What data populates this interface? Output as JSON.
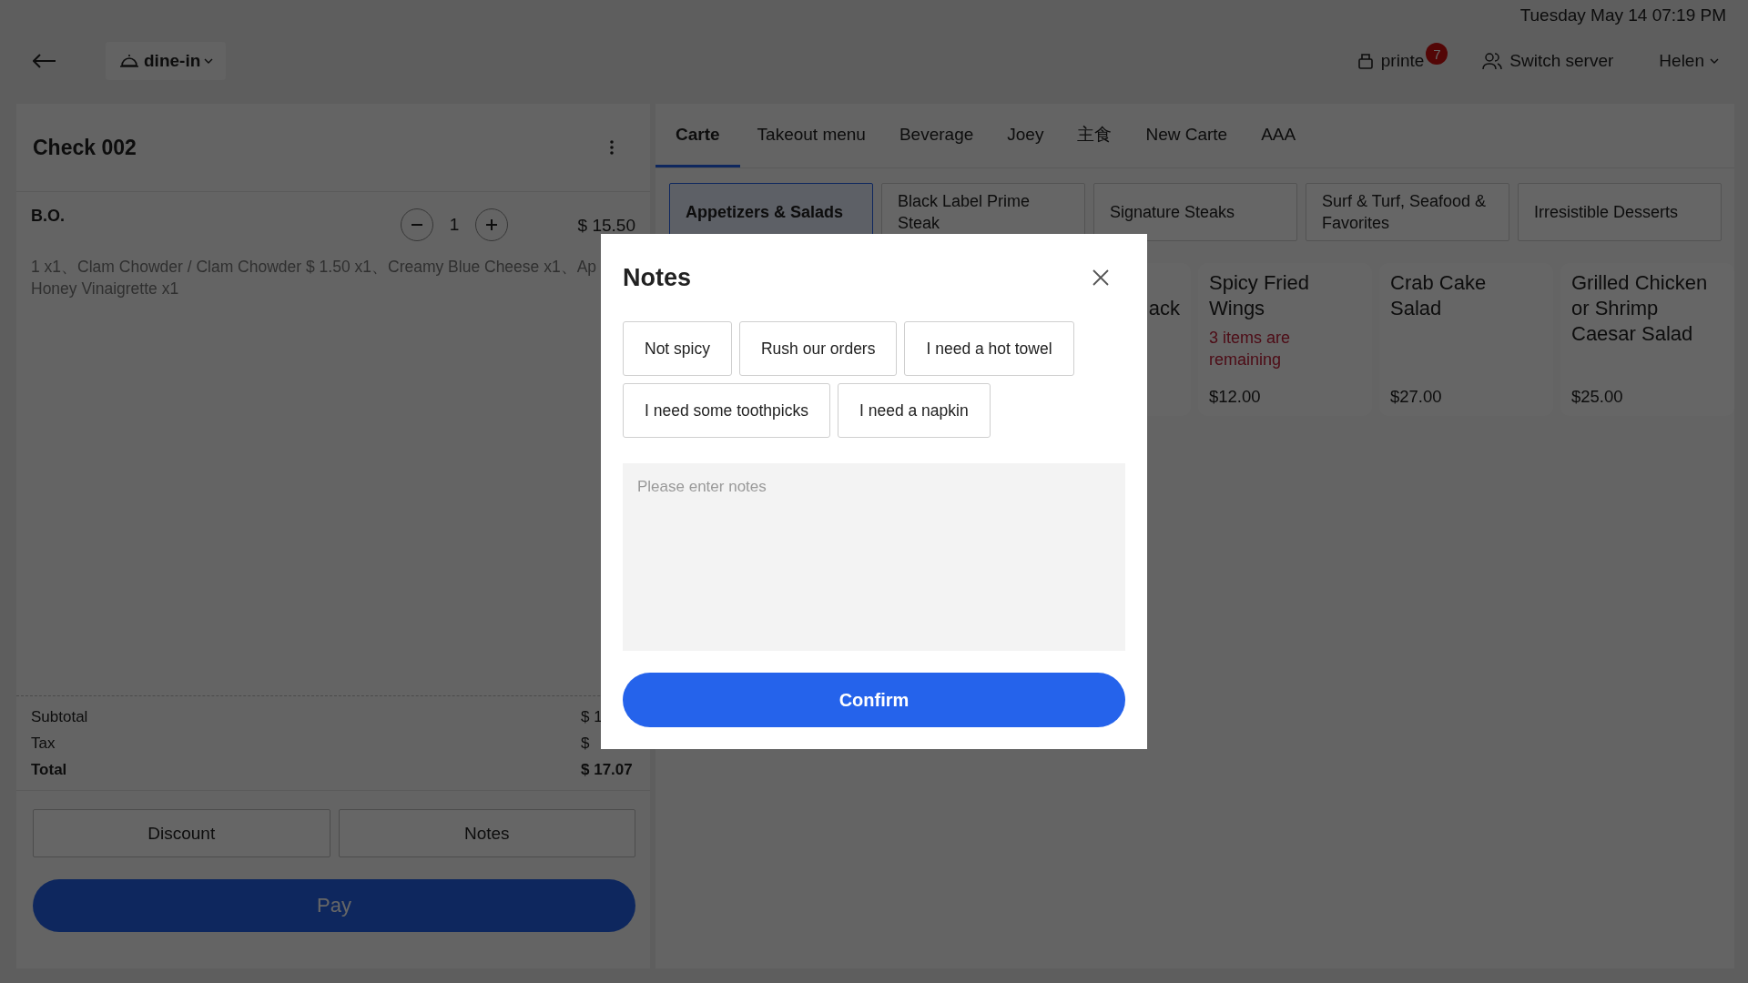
{
  "status": {
    "datetime": "Tuesday May 14 07:19 PM"
  },
  "header": {
    "order_type": "dine-in",
    "printer": {
      "label": "printe",
      "badge": "7"
    },
    "switch_server": "Switch server",
    "user": "Helen"
  },
  "check": {
    "title": "Check 002",
    "items": [
      {
        "name": "B.O.",
        "quantity": "1",
        "price": "$ 15.50",
        "modifiers": [
          "1 x1、Clam Chowder / Clam Chowder $ 1.50 x1、Creamy Blue Cheese x1、Ap",
          "Honey Vinaigrette x1"
        ]
      }
    ],
    "summary": [
      {
        "label": "Subtotal",
        "value": "$ 1",
        "kind": "normal"
      },
      {
        "label": "Tax",
        "value": "$",
        "kind": "normal"
      },
      {
        "label": "Total",
        "value": "$ 17.07",
        "kind": "total"
      }
    ],
    "buttons": [
      "Discount",
      "Notes"
    ],
    "pay": "Pay"
  },
  "menu": {
    "tabs": [
      {
        "label": "Carte",
        "selected": true
      },
      {
        "label": "Takeout menu",
        "selected": false
      },
      {
        "label": "Beverage",
        "selected": false
      },
      {
        "label": "Joey",
        "selected": false
      },
      {
        "label": "主食",
        "selected": false
      },
      {
        "label": "New Carte",
        "selected": false
      },
      {
        "label": "AAA",
        "selected": false
      }
    ],
    "categories": [
      {
        "label": "Appetizers & Salads",
        "selected": true
      },
      {
        "label": "Black Label Prime Steak",
        "selected": false
      },
      {
        "label": "Signature Steaks",
        "selected": false
      },
      {
        "label": "Surf & Turf, Seafood & Favorites",
        "selected": false
      },
      {
        "label": "Irresistible Desserts",
        "selected": false
      }
    ],
    "items": [
      {
        "kind": "partial",
        "name": "ack"
      },
      {
        "kind": "item",
        "name": "Spicy Fried Wings",
        "stock_note": "3 items are remaining",
        "price": "$12.00"
      },
      {
        "kind": "item",
        "name": "Crab Cake Salad",
        "price": "$27.00"
      },
      {
        "kind": "item",
        "name": "Grilled Chicken or Shrimp Caesar Salad",
        "price": "$25.00"
      }
    ]
  },
  "dialog": {
    "title": "Notes",
    "chips": [
      "Not spicy",
      "Rush our orders",
      "I need a hot towel",
      "I need some toothpicks",
      "I need a napkin"
    ],
    "notes": {
      "placeholder": "Please enter notes"
    },
    "confirm": "Confirm"
  }
}
